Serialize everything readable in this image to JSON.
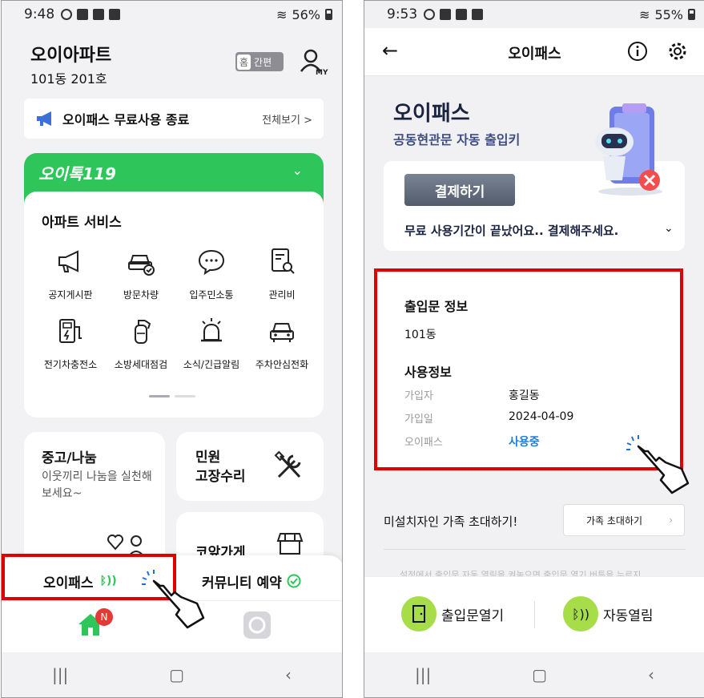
{
  "left_phone": {
    "status": {
      "time": "9:48",
      "battery": "56%"
    },
    "header": {
      "apartment": "오이아파트",
      "unit": "101동 201호",
      "mode_home": "홈",
      "mode_simple": "간편",
      "my_label": "MY"
    },
    "notice": {
      "title": "오이패스 무료사용 종료",
      "more": "전체보기 >"
    },
    "promo": {
      "logo": "오이톡119"
    },
    "services": {
      "heading": "아파트 서비스",
      "items": [
        {
          "label": "공지게시판",
          "icon": "megaphone-icon"
        },
        {
          "label": "방문차량",
          "icon": "car-check-icon"
        },
        {
          "label": "입주민소통",
          "icon": "chat-bubble-icon"
        },
        {
          "label": "관리비",
          "icon": "bill-search-icon"
        },
        {
          "label": "전기차충전소",
          "icon": "ev-charger-icon"
        },
        {
          "label": "소방세대점검",
          "icon": "fire-extinguisher-icon"
        },
        {
          "label": "소식/긴급알림",
          "icon": "siren-icon"
        },
        {
          "label": "주차안심전화",
          "icon": "car-icon"
        }
      ]
    },
    "tiles": {
      "trade_title": "중고/나눔",
      "trade_desc": "이웃끼리 나눔을 실천해 보세요~",
      "civil_title": "민원\n고장수리",
      "shop_title": "코앞가게"
    },
    "sheet": {
      "opass": "오이패스",
      "community": "커뮤니티 예약"
    },
    "tabbar": {
      "badge": "N"
    }
  },
  "right_phone": {
    "status": {
      "time": "9:53",
      "battery": "55%"
    },
    "topbar": {
      "title": "오이패스"
    },
    "hero": {
      "title": "오이패스",
      "subtitle": "공동현관문 자동 출입키"
    },
    "payment": {
      "button": "결제하기",
      "message": "무료 사용기간이 끝났어요.. 결제해주세요."
    },
    "info": {
      "gate_heading": "출입문 정보",
      "gate_value": "101동",
      "usage_heading": "사용정보",
      "rows": [
        {
          "key": "가입자",
          "value": "홍길동"
        },
        {
          "key": "가입일",
          "value": "2024-04-09"
        },
        {
          "key": "오이패스",
          "value": "사용중"
        }
      ]
    },
    "invite": {
      "text": "미설치자인 가족 초대하기!",
      "button": "가족 초대하기"
    },
    "faded_text": "설정에서 출입문 자동 열림을 켜놓으면 출입문 열기 버튼을 누르지",
    "actions": {
      "open_door": "출입문열기",
      "auto_open": "자동열림"
    }
  },
  "colors": {
    "green": "#2ec65a",
    "highlight": "#e00000",
    "status_blue": "#1f7fd6",
    "lime": "#a8dd4a"
  }
}
